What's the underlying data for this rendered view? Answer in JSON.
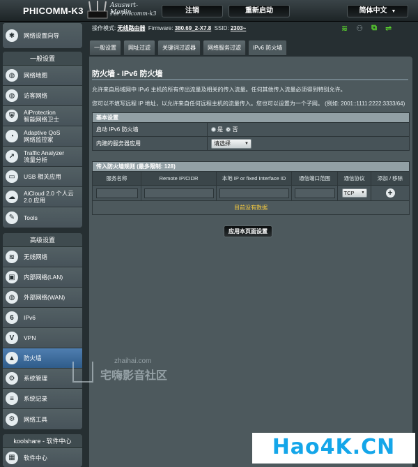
{
  "header": {
    "brand": "PHICOMM-K3",
    "logo_line1": "Asuswrt-Merlin",
    "logo_line2": "For Phicomm-k3",
    "logout_label": "注销",
    "reboot_label": "重新启动",
    "language": "简体中文"
  },
  "status": {
    "mode_label": "操作模式:",
    "mode_value": "无线路由器",
    "firmware_label": "Firmware:",
    "firmware_value": "380.69_2-X7.8",
    "ssid_label": "SSID:",
    "ssid_value": "2303~"
  },
  "sidebar": {
    "quick_setup": "网络设置向导",
    "general_header": "一般设置",
    "general_items": [
      {
        "label": "网络地图",
        "icon": "globe-icon"
      },
      {
        "label": "访客网络",
        "icon": "guest-network-icon"
      },
      {
        "label": "AiProtection\n智能网络卫士",
        "icon": "shield-lock-icon"
      },
      {
        "label": "Adaptive QoS\n网络监控家",
        "icon": "qos-icon"
      },
      {
        "label": "Traffic Analyzer\n流量分析",
        "icon": "chart-icon"
      },
      {
        "label": "USB 相关应用",
        "icon": "usb-icon"
      },
      {
        "label": "AiCloud 2.0 个人云\n2.0 应用",
        "icon": "cloud-icon"
      },
      {
        "label": "Tools",
        "icon": "wrench-icon"
      }
    ],
    "advanced_header": "高级设置",
    "advanced_items": [
      {
        "label": "无线网络",
        "icon": "wifi-icon"
      },
      {
        "label": "内部网络(LAN)",
        "icon": "lan-icon"
      },
      {
        "label": "外部网络(WAN)",
        "icon": "wan-globe-icon"
      },
      {
        "label": "IPv6",
        "icon": "ipv6-icon"
      },
      {
        "label": "VPN",
        "icon": "vpn-icon"
      },
      {
        "label": "防火墙",
        "icon": "firewall-icon"
      },
      {
        "label": "系统管理",
        "icon": "gears-icon"
      },
      {
        "label": "系统记录",
        "icon": "log-icon"
      },
      {
        "label": "网络工具",
        "icon": "tools-icon"
      }
    ],
    "koolshare_header": "koolshare - 软件中心",
    "koolshare_item": "软件中心"
  },
  "tabs": [
    "一般设置",
    "网址过滤",
    "关键词过滤器",
    "网络服务过滤",
    "IPv6 防火墙"
  ],
  "content": {
    "title": "防火墙 - IPv6 防火墙",
    "desc1": "允许来自局域网中 IPv6 主机的所有传出流量及相关的传入流量。任何其他传入流量必须得到特别允许。",
    "desc2": "您可以不填写远程 IP 地址，以允许来自任何远程主机的流量传入。您也可以设置为一个子网。 (例如:  2001::1111:2222:3333/64)",
    "basic_header": "基本设置",
    "enable_label": "启动 IPv6 防火墙",
    "radio_yes": "是",
    "radio_no": "否",
    "service_label": "内建的服务器应用",
    "service_select": "请选择",
    "rules_header": "传入防火墙规则 (最多限制:  128)",
    "columns": [
      "服务名称",
      "Remote IP/CIDR",
      "本地 IP or fixed Interface ID",
      "通信端口范围",
      "通信协议",
      "添加 / 移除"
    ],
    "protocol": "TCP",
    "empty_text": "目前没有数据",
    "apply_label": "应用本页面设置"
  },
  "watermarks": {
    "site_small": "zhaihai.com",
    "site_big": "宅嗨影音社区",
    "hao4k": "Hao4K.CN"
  }
}
